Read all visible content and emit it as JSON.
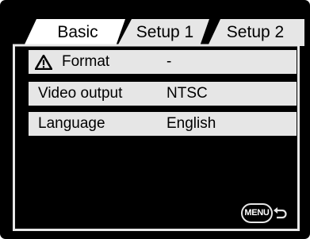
{
  "tabs": [
    {
      "label": "Basic",
      "active": true
    },
    {
      "label": "Setup 1",
      "active": false
    },
    {
      "label": "Setup 2",
      "active": false
    }
  ],
  "menu_rows": [
    {
      "label": "Format",
      "value": "-",
      "icon": "warning-icon"
    },
    {
      "label": "Video output",
      "value": "NTSC"
    },
    {
      "label": "Language",
      "value": "English"
    }
  ],
  "footer": {
    "menu_label": "MENU",
    "return_icon": "return-arrow-icon"
  },
  "colors": {
    "background": "#000000",
    "tab_active": "#ffffff",
    "tab_inactive": "#e6e6e6",
    "row_background": "#e6e6e6",
    "panel_border": "#e8e8e8"
  }
}
